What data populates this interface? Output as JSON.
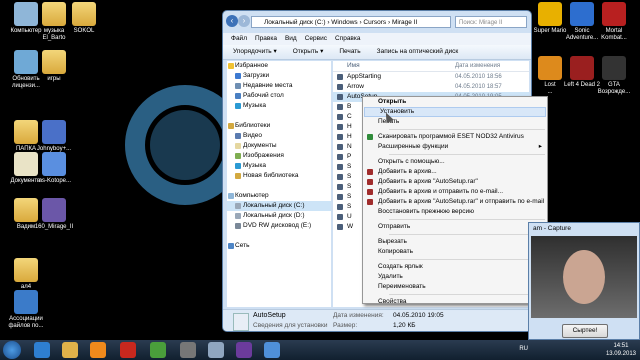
{
  "desktop": {
    "icons": [
      {
        "label": "Компьютер",
        "color": "#8fb6d8"
      },
      {
        "label": "музыка\nEl_Barto",
        "color": "folder"
      },
      {
        "label": "SOKOL",
        "color": "folder"
      },
      {
        "label": "Обновить\nлицензи...",
        "color": "#6fa9d6"
      },
      {
        "label": "игры",
        "color": "folder"
      },
      {
        "label": "ПАПКА\nМАМЫ",
        "color": "folder"
      },
      {
        "label": "Johnyboy+...",
        "color": "#4a70c8"
      },
      {
        "label": "Документы",
        "color": "#e9e3c6"
      },
      {
        "label": "ms-Kotope...",
        "color": "#5a8fe0"
      },
      {
        "label": "Вадим",
        "color": "folder"
      },
      {
        "label": "160_Mirage_II",
        "color": "#6b57a8"
      },
      {
        "label": "ал4",
        "color": "folder"
      },
      {
        "label": "Ассоциации\nфайлов по...",
        "color": "#3b7bc9"
      },
      {
        "label": "Super Mario",
        "color": "#e8b000"
      },
      {
        "label": "Sonic\nAdventure...",
        "color": "#2d6ecf"
      },
      {
        "label": "Mortal\nKombat...",
        "color": "#b82020"
      },
      {
        "label": "Lost\n...",
        "color": "#dd8a1c"
      },
      {
        "label": "Left 4 Dead 2",
        "color": "#9a1f1f"
      },
      {
        "label": "GTA\nВозрожде...",
        "color": "#333"
      }
    ]
  },
  "explorer": {
    "address": "Локальный диск (C:)  ›  Windows  ›  Cursors  ›  Mirage II",
    "search_placeholder": "Поиск: Mirage II",
    "menu": [
      "Файл",
      "Правка",
      "Вид",
      "Сервис",
      "Справка"
    ],
    "toolbar": [
      "Упорядочить ▾",
      "Открыть ▾",
      "Печать",
      "Запись на оптический диск"
    ],
    "nav": [
      {
        "label": "Избранное",
        "group": true,
        "color": "#f1c232"
      },
      {
        "label": "Загрузки",
        "group": false,
        "color": "#3d7ad1"
      },
      {
        "label": "Недавние места",
        "group": false,
        "color": "#6f8fb3"
      },
      {
        "label": "Рабочий стол",
        "group": false,
        "color": "#4a7fc2"
      },
      {
        "label": "Музыка",
        "group": false,
        "color": "#2b9ad3"
      },
      {
        "label": "",
        "group": false,
        "color": "transparent"
      },
      {
        "label": "Библиотеки",
        "group": true,
        "color": "#d3a940"
      },
      {
        "label": "Видео",
        "group": false,
        "color": "#5a7bb0"
      },
      {
        "label": "Документы",
        "group": false,
        "color": "#e5d7a0"
      },
      {
        "label": "Изображения",
        "group": false,
        "color": "#7fae52"
      },
      {
        "label": "Музыка",
        "group": false,
        "color": "#2b9ad3"
      },
      {
        "label": "Новая библиотека",
        "group": false,
        "color": "#d3a940"
      },
      {
        "label": "",
        "group": false,
        "color": "transparent"
      },
      {
        "label": "Компьютер",
        "group": true,
        "color": "#8fb6d8"
      },
      {
        "label": "Локальный диск (C:)",
        "group": false,
        "color": "#9aa8b8",
        "selected": true
      },
      {
        "label": "Локальный диск (D:)",
        "group": false,
        "color": "#9aa8b8"
      },
      {
        "label": "DVD RW дисковод (E:)",
        "group": false,
        "color": "#7a8898"
      },
      {
        "label": "",
        "group": false,
        "color": "transparent"
      },
      {
        "label": "Сеть",
        "group": true,
        "color": "#4f86c6"
      }
    ],
    "column_name": "Имя",
    "column_date": "Дата изменения",
    "files": [
      {
        "name": "AppStarting",
        "date": "04.05.2010 18:56"
      },
      {
        "name": "Arrow",
        "date": "04.05.2010 18:57"
      },
      {
        "name": "AutoSetup",
        "date": "04.05.2010 19:05",
        "selected": true
      },
      {
        "name": "B",
        "date": ""
      },
      {
        "name": "C",
        "date": ""
      },
      {
        "name": "H",
        "date": ""
      },
      {
        "name": "H",
        "date": ""
      },
      {
        "name": "N",
        "date": ""
      },
      {
        "name": "P",
        "date": ""
      },
      {
        "name": "S",
        "date": ""
      },
      {
        "name": "S",
        "date": ""
      },
      {
        "name": "S",
        "date": ""
      },
      {
        "name": "S",
        "date": ""
      },
      {
        "name": "S",
        "date": ""
      },
      {
        "name": "U",
        "date": ""
      },
      {
        "name": "W",
        "date": ""
      }
    ],
    "details": {
      "name": "AutoSetup",
      "type": "Сведения для установки",
      "date_label": "Дата изменения:",
      "date_value": "04.05.2010 19:05",
      "size_label": "Размер:",
      "size_value": "1,20 КБ"
    }
  },
  "context_menu": [
    {
      "label": "Открыть",
      "bold": true
    },
    {
      "label": "Установить",
      "highlight": true
    },
    {
      "label": "Печать"
    },
    {
      "sep": true
    },
    {
      "label": "Сканировать программой ESET NOD32 Antivirus",
      "icon": "#2f8b3a"
    },
    {
      "label": "Расширенные функции",
      "arrow": true
    },
    {
      "sep": true
    },
    {
      "label": "Открыть с помощью..."
    },
    {
      "label": "Добавить в архив...",
      "icon": "#a02c2c"
    },
    {
      "label": "Добавить в архив \"AutoSetup.rar\"",
      "icon": "#a02c2c"
    },
    {
      "label": "Добавить в архив и отправить по e-mail...",
      "icon": "#a02c2c"
    },
    {
      "label": "Добавить в архив \"AutoSetup.rar\" и отправить по e-mail",
      "icon": "#a02c2c"
    },
    {
      "label": "Восстановить прежнюю версию"
    },
    {
      "sep": true
    },
    {
      "label": "Отправить",
      "arrow": true
    },
    {
      "sep": true
    },
    {
      "label": "Вырезать"
    },
    {
      "label": "Копировать"
    },
    {
      "sep": true
    },
    {
      "label": "Создать ярлык"
    },
    {
      "label": "Удалить"
    },
    {
      "label": "Переименовать"
    },
    {
      "sep": true
    },
    {
      "label": "Свойства"
    }
  ],
  "cam": {
    "title": "am - Capture",
    "button": "Сыртее!"
  },
  "taskbar": {
    "lang": "RU",
    "time": "14:51",
    "date": "13.09.2013"
  }
}
